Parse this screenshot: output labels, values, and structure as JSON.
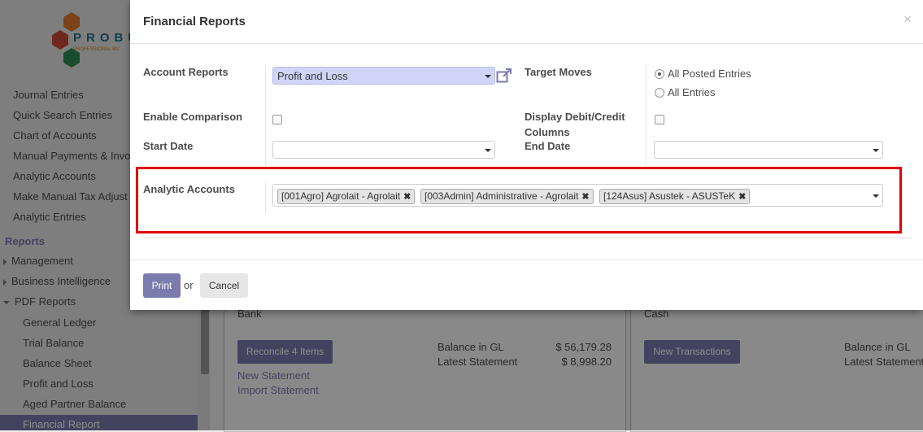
{
  "sidebar": {
    "brand": {
      "name": "PROBU",
      "tagline": "PROFESSIONAL BU"
    },
    "items": [
      {
        "label": "Journal Entries"
      },
      {
        "label": "Quick Search Entries"
      },
      {
        "label": "Chart of Accounts"
      },
      {
        "label": "Manual Payments & Invo"
      },
      {
        "label": "Analytic Accounts"
      },
      {
        "label": "Make Manual Tax Adjust"
      },
      {
        "label": "Analytic Entries"
      }
    ],
    "section": "Reports",
    "groups": [
      {
        "label": "Management"
      },
      {
        "label": "Business Intelligence"
      },
      {
        "label": "PDF Reports"
      }
    ],
    "sub_items": [
      {
        "label": "General Ledger"
      },
      {
        "label": "Trial Balance"
      },
      {
        "label": "Balance Sheet"
      },
      {
        "label": "Profit and Loss"
      },
      {
        "label": "Aged Partner Balance"
      },
      {
        "label": "Financial Report"
      }
    ]
  },
  "dashboard": {
    "left_card": {
      "title": "Bank",
      "button": "Reconcile 4 Items",
      "links": [
        "New Statement",
        "Import Statement"
      ],
      "rows": [
        {
          "label": "Balance in GL",
          "value": "$ 56,179.28"
        },
        {
          "label": "Latest Statement",
          "value": "$ 8,998.20"
        }
      ]
    },
    "right_card": {
      "title": "Cash",
      "button": "New Transactions",
      "rows": [
        {
          "label": "Balance in GL"
        },
        {
          "label": "Latest Statement"
        }
      ]
    }
  },
  "modal": {
    "title": "Financial Reports",
    "close": "×",
    "account_reports": {
      "label": "Account Reports",
      "value": "Profit and Loss"
    },
    "target_moves": {
      "label": "Target Moves",
      "options": [
        {
          "label": "All Posted Entries",
          "selected": true
        },
        {
          "label": "All Entries",
          "selected": false
        }
      ]
    },
    "enable_comparison": {
      "label": "Enable Comparison",
      "checked": false
    },
    "display_debit_credit": {
      "label_line1": "Display Debit/Credit",
      "label_line2": "Columns",
      "checked": false
    },
    "start_date": {
      "label": "Start Date",
      "value": ""
    },
    "end_date": {
      "label": "End Date",
      "value": ""
    },
    "analytic_accounts": {
      "label": "Analytic Accounts",
      "tags": [
        "[001Agro] Agrolait - Agrolait",
        "[003Admin] Administrative - Agrolait",
        "[124Asus] Asustek - ASUSTeK"
      ]
    },
    "footer": {
      "print": "Print",
      "or": "or",
      "cancel": "Cancel"
    }
  },
  "colors": {
    "accent": "#7c7bad",
    "highlight": "#e0000a",
    "select_highlight": "#d0d4f7"
  }
}
